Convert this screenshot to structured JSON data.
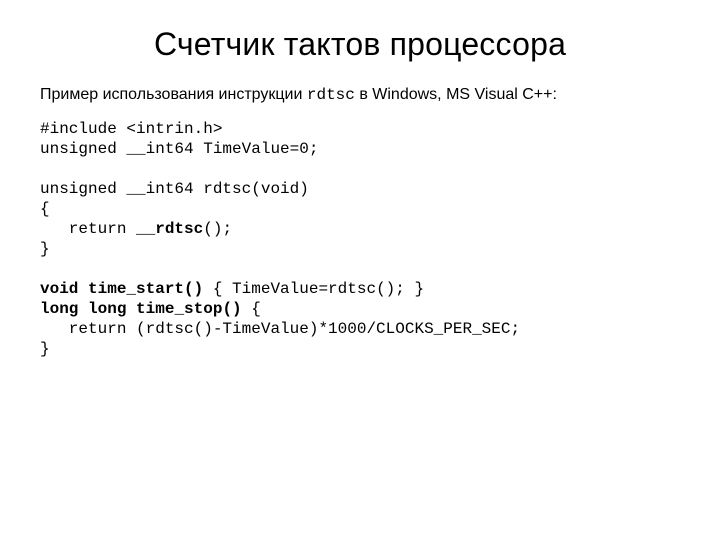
{
  "title": "Счетчик тактов процессора",
  "desc_pre": "Пример использования инструкции ",
  "desc_code": "rdtsc",
  "desc_post": " в Windows, MS Visual C++:",
  "code": {
    "l1": "#include <intrin.h>",
    "l2": "unsigned __int64 TimeValue=0;",
    "l3": "",
    "l4": "unsigned __int64 rdtsc(void)",
    "l5": "{",
    "l6a": "   return ",
    "l6b": "__rdtsc",
    "l6c": "();",
    "l7": "}",
    "l8": "",
    "l9a": "void",
    "l9b": " ",
    "l9c": "time_start()",
    "l9d": " { TimeValue=rdtsc(); }",
    "l10a": "long long",
    "l10b": " ",
    "l10c": "time_stop()",
    "l10d": " {",
    "l11": "   return (rdtsc()-TimeValue)*1000/CLOCKS_PER_SEC;",
    "l12": "}"
  }
}
